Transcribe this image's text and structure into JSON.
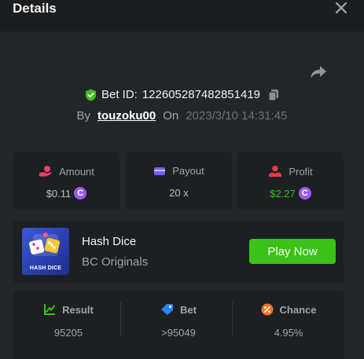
{
  "header": {
    "title": "Details",
    "close_icon": "close-icon"
  },
  "bet": {
    "id_label": "Bet ID:",
    "id_value": "122605287482851419",
    "by_label": "By",
    "username": "touzoku00",
    "on_label": "On",
    "datetime": "2023/3/10 14:31:45"
  },
  "stats": [
    {
      "label": "Amount",
      "value": "$0.11",
      "icon": "hand-coins-icon",
      "coin": true
    },
    {
      "label": "Payout",
      "value": "20 x",
      "icon": "wallet-icon",
      "coin": false
    },
    {
      "label": "Profit",
      "value": "$2.27",
      "icon": "profit-icon",
      "coin": true
    }
  ],
  "game": {
    "name": "Hash Dice",
    "provider": "BC Originals",
    "thumb_label": "HASH DICE",
    "play_label": "Play Now"
  },
  "results": [
    {
      "label": "Result",
      "value": "95205",
      "icon": "result-icon"
    },
    {
      "label": "Bet",
      "value": ">95049",
      "icon": "bet-tag-icon"
    },
    {
      "label": "Chance",
      "value": "4.95%",
      "icon": "percent-icon"
    }
  ],
  "colors": {
    "accent_green": "#3bc117",
    "profit_green": "#3bc117",
    "coin_purple": "#9a5cf3",
    "amount_pink": "#ec3f6a",
    "payout_purple": "#7c5cf5",
    "profit_red": "#e83a45",
    "result_green": "#3bc117",
    "bet_blue": "#2d7ff9",
    "chance_orange": "#f5721f"
  }
}
